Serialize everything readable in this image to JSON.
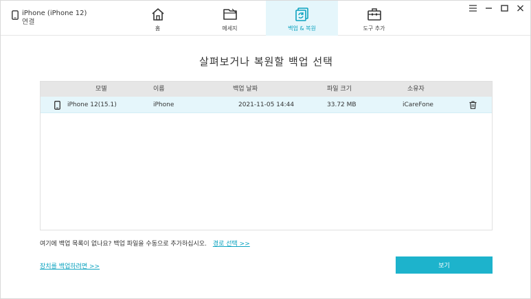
{
  "device": {
    "name": "iPhone (iPhone 12)",
    "status": "연결"
  },
  "nav": [
    {
      "label": "홈",
      "icon": "home-icon",
      "active": false
    },
    {
      "label": "메세지",
      "icon": "folder-icon",
      "active": false
    },
    {
      "label": "백업 & 복원",
      "icon": "backup-restore-icon",
      "active": true
    },
    {
      "label": "도구 추가",
      "icon": "toolbox-icon",
      "active": false
    }
  ],
  "colors": {
    "accent": "#0aa2bf",
    "button": "#1db3cc",
    "active_bg": "#e5f6fb"
  },
  "main": {
    "title": "살펴보거나 복원할 백업 선택",
    "columns": {
      "model": "모델",
      "name": "이름",
      "date": "백업 날짜",
      "size": "파일 크기",
      "owner": "소유자"
    },
    "rows": [
      {
        "model": "iPhone 12(15.1)",
        "name": "iPhone",
        "date": "2021-11-05 14:44",
        "size": "33.72 MB",
        "owner": "iCareFone"
      }
    ],
    "hint_text": "여기에 백업 목록이 없나요? 백업 파일을 수동으로 추가하십시오.",
    "hint_link": "경로 선택 >>",
    "backup_link": "장치를 백업하려면 >>",
    "view_button": "보기"
  }
}
